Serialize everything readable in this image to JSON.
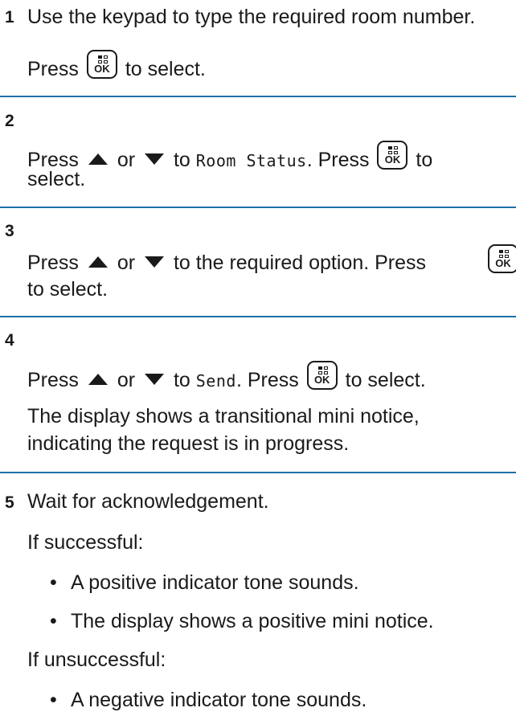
{
  "ok_key": {
    "label": "OK"
  },
  "steps": [
    {
      "number": "1",
      "line1": "Use the keypad to type the required room number.",
      "press": "Press",
      "to_select": "to select."
    },
    {
      "number": "2",
      "press": "Press",
      "or": "or",
      "to": "to",
      "menu_item": "Room Status",
      "dot_press": ". Press",
      "to_end": "to",
      "select": "select."
    },
    {
      "number": "3",
      "press": "Press",
      "or": "or",
      "rest": "to the required option. Press",
      "to_select": "to select."
    },
    {
      "number": "4",
      "press": "Press",
      "or": "or",
      "to": "to",
      "menu_item": "Send",
      "dot_press": ". Press",
      "to_select": "to select.",
      "note1": "The display shows a transitional mini notice,",
      "note2": "indicating the request is in progress."
    },
    {
      "number": "5",
      "line1": "Wait for acknowledgement.",
      "success_label": "If successful:",
      "success_bullets": [
        "A positive indicator tone sounds.",
        "The display shows a positive mini notice."
      ],
      "fail_label": "If unsuccessful:",
      "fail_bullets": [
        "A negative indicator tone sounds."
      ]
    }
  ],
  "colors": {
    "separator": "#1e6fa8",
    "text": "#1a1a1a"
  }
}
